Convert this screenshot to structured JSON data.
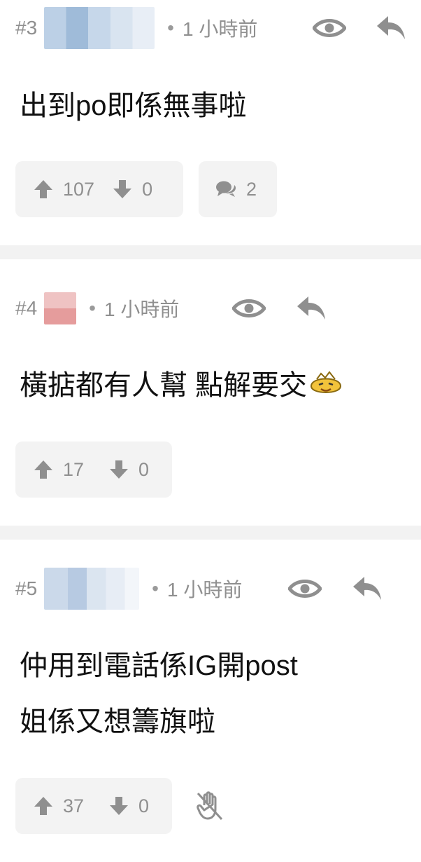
{
  "posts": [
    {
      "num": "#3",
      "time": "1 小時前",
      "lines": [
        "出到po即係無事啦"
      ],
      "upvotes": "107",
      "downvotes": "0",
      "replies": "2",
      "icons": {
        "view": "eye-icon",
        "reply": "reply-arrow-icon",
        "up": "thumb-up-arrow-icon",
        "down": "thumb-down-arrow-icon",
        "comments": "comment-bubbles-icon"
      }
    },
    {
      "num": "#4",
      "time": "1 小時前",
      "lines": [
        "橫掂都有人幫 點解要交"
      ],
      "upvotes": "17",
      "downvotes": "0",
      "icons": {
        "view": "eye-icon",
        "reply": "reply-arrow-icon",
        "emoji": "laughing-face-emoji-icon"
      }
    },
    {
      "num": "#5",
      "time": "1 小時前",
      "lines": [
        "仲用到電話係IG開post",
        "姐係又想籌旗啦"
      ],
      "upvotes": "37",
      "downvotes": "0",
      "icons": {
        "view": "eye-icon",
        "reply": "reply-arrow-icon",
        "extra": "muted-hand-icon"
      }
    }
  ],
  "colors": {
    "accent": "#8f8f8f",
    "box": "#f3f3f3",
    "separator": "#f2f2f2",
    "text": "#111111"
  }
}
